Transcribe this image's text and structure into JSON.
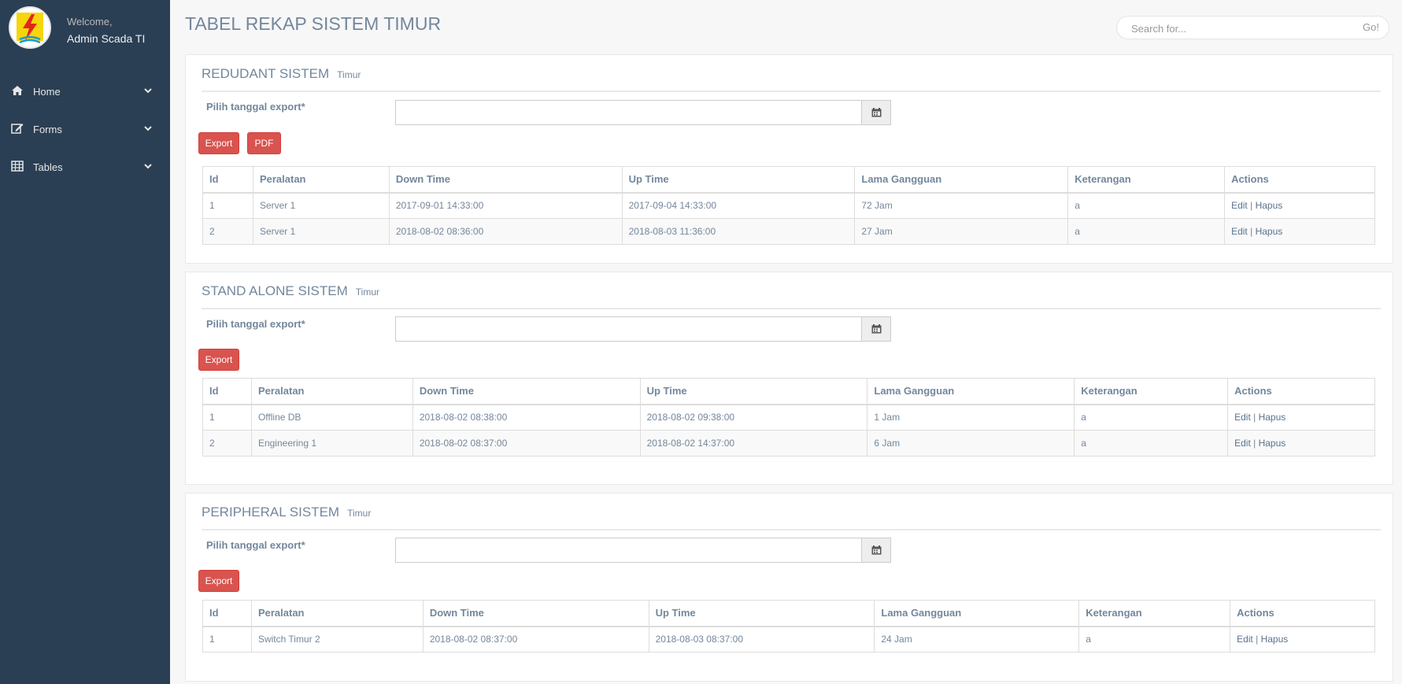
{
  "app": {
    "welcome": "Welcome,",
    "user": "Admin Scada TI"
  },
  "sidebar": {
    "items": [
      {
        "label": "Home",
        "icon": "home-icon"
      },
      {
        "label": "Forms",
        "icon": "edit-icon"
      },
      {
        "label": "Tables",
        "icon": "table-icon"
      }
    ]
  },
  "page": {
    "title": "TABEL REKAP SISTEM TIMUR"
  },
  "search": {
    "placeholder": "Search for...",
    "go_label": "Go!"
  },
  "colors": {
    "sidebar": "#2A3F54",
    "danger": "#d9534f",
    "text": "#73879C"
  },
  "columns": [
    "Id",
    "Peralatan",
    "Down Time",
    "Up Time",
    "Lama Gangguan",
    "Keterangan",
    "Actions"
  ],
  "action_labels": {
    "edit": "Edit",
    "sep": "|",
    "delete": "Hapus"
  },
  "panels": [
    {
      "title": "REDUDANT SISTEM",
      "subtitle": "Timur",
      "export_label": "Pilih tanggal export*",
      "buttons": [
        "Export",
        "PDF"
      ],
      "rows": [
        {
          "id": "1",
          "peralatan": "Server 1",
          "down": "2017-09-01 14:33:00",
          "up": "2017-09-04 14:33:00",
          "lama": "72 Jam",
          "ket": "a"
        },
        {
          "id": "2",
          "peralatan": "Server 1",
          "down": "2018-08-02 08:36:00",
          "up": "2018-08-03 11:36:00",
          "lama": "27 Jam",
          "ket": "a"
        }
      ]
    },
    {
      "title": "STAND ALONE SISTEM",
      "subtitle": "Timur",
      "export_label": "Pilih tanggal export*",
      "buttons": [
        "Export"
      ],
      "rows": [
        {
          "id": "1",
          "peralatan": "Offline DB",
          "down": "2018-08-02 08:38:00",
          "up": "2018-08-02 09:38:00",
          "lama": "1 Jam",
          "ket": "a"
        },
        {
          "id": "2",
          "peralatan": "Engineering 1",
          "down": "2018-08-02 08:37:00",
          "up": "2018-08-02 14:37:00",
          "lama": "6 Jam",
          "ket": "a"
        }
      ]
    },
    {
      "title": "PERIPHERAL SISTEM",
      "subtitle": "Timur",
      "export_label": "Pilih tanggal export*",
      "buttons": [
        "Export"
      ],
      "rows": [
        {
          "id": "1",
          "peralatan": "Switch Timur 2",
          "down": "2018-08-02 08:37:00",
          "up": "2018-08-03 08:37:00",
          "lama": "24 Jam",
          "ket": "a"
        }
      ]
    }
  ]
}
